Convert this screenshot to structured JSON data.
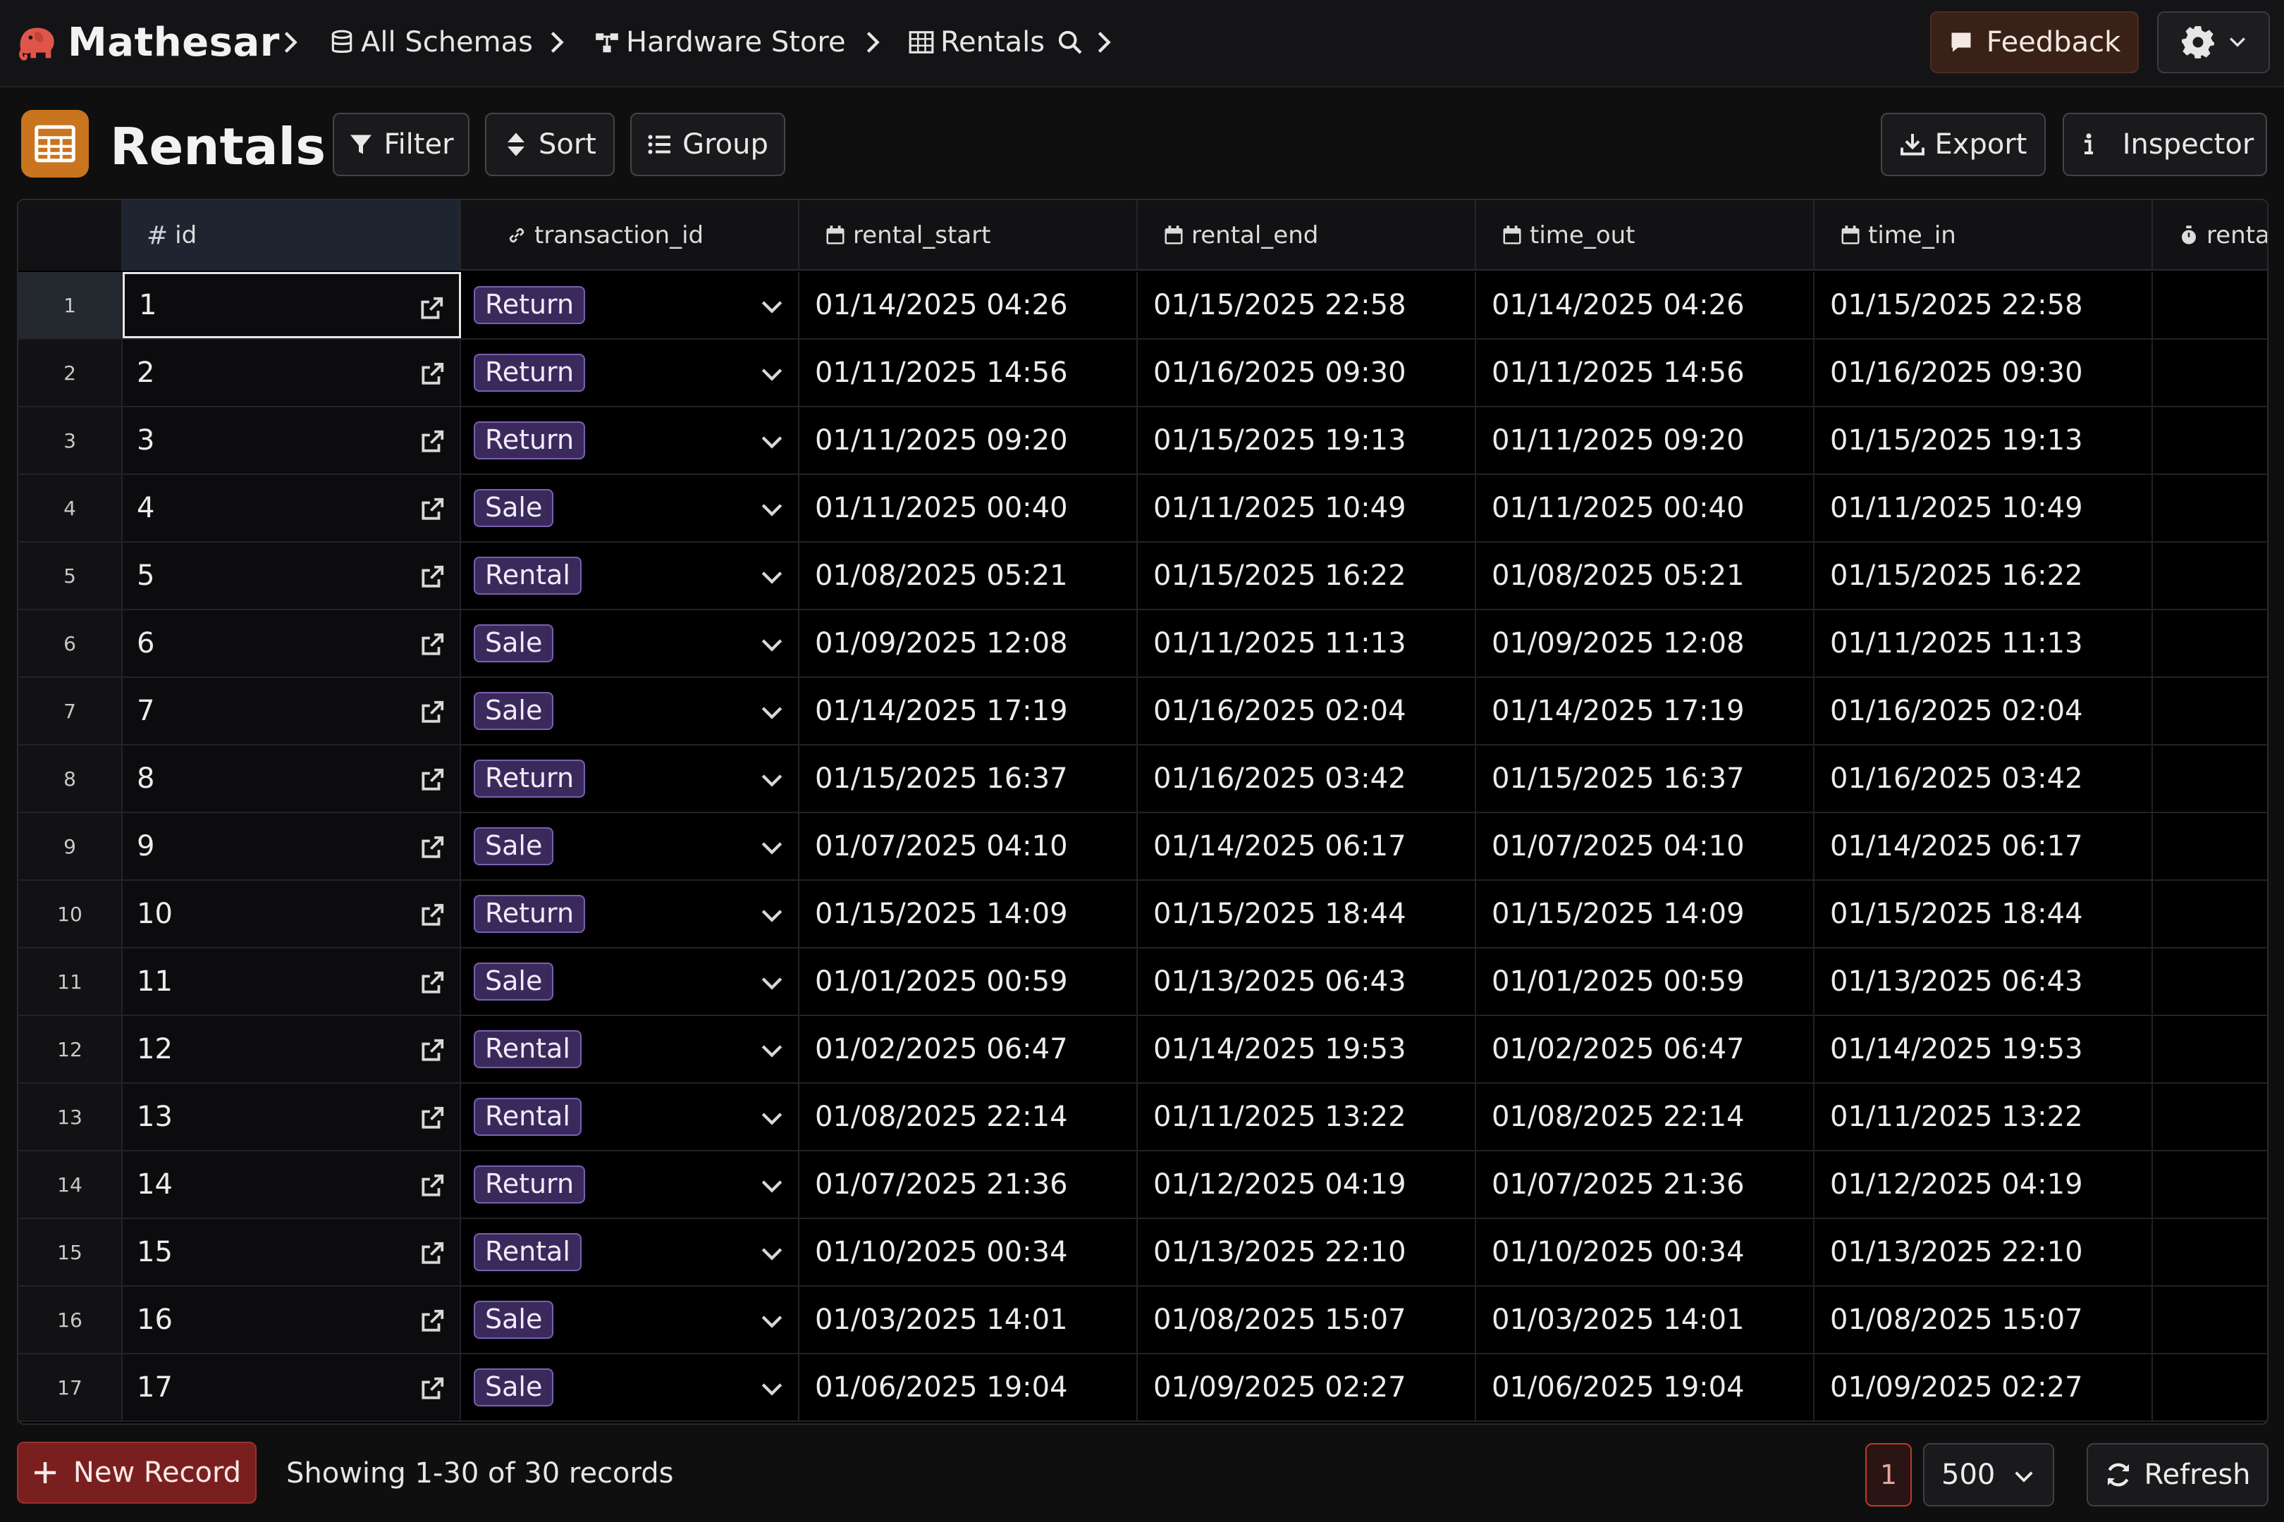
{
  "app": {
    "name": "Mathesar"
  },
  "breadcrumbs": [
    {
      "label": "All Schemas",
      "icon": "database-icon"
    },
    {
      "label": "Hardware Store",
      "icon": "schema-icon"
    },
    {
      "label": "Rentals",
      "icon": "table-icon"
    }
  ],
  "topbar": {
    "feedback_label": "Feedback",
    "settings_icon": "gear-icon"
  },
  "table": {
    "title": "Rentals"
  },
  "actions": {
    "filter": "Filter",
    "sort": "Sort",
    "group": "Group",
    "export": "Export",
    "inspector": "Inspector"
  },
  "columns": [
    {
      "name": "id",
      "icon": "hash-icon"
    },
    {
      "name": "transaction_id",
      "icon": "link-icon"
    },
    {
      "name": "rental_start",
      "icon": "calendar-icon"
    },
    {
      "name": "rental_end",
      "icon": "calendar-icon"
    },
    {
      "name": "time_out",
      "icon": "calendar-icon"
    },
    {
      "name": "time_in",
      "icon": "calendar-icon"
    },
    {
      "name": "renta",
      "icon": "stopwatch-icon"
    }
  ],
  "rows": [
    {
      "n": "1",
      "id": "1",
      "tx": "Return",
      "rs": "01/14/2025 04:26",
      "re": "01/15/2025 22:58",
      "to": "01/14/2025 04:26",
      "ti": "01/15/2025 22:58"
    },
    {
      "n": "2",
      "id": "2",
      "tx": "Return",
      "rs": "01/11/2025 14:56",
      "re": "01/16/2025 09:30",
      "to": "01/11/2025 14:56",
      "ti": "01/16/2025 09:30"
    },
    {
      "n": "3",
      "id": "3",
      "tx": "Return",
      "rs": "01/11/2025 09:20",
      "re": "01/15/2025 19:13",
      "to": "01/11/2025 09:20",
      "ti": "01/15/2025 19:13"
    },
    {
      "n": "4",
      "id": "4",
      "tx": "Sale",
      "rs": "01/11/2025 00:40",
      "re": "01/11/2025 10:49",
      "to": "01/11/2025 00:40",
      "ti": "01/11/2025 10:49"
    },
    {
      "n": "5",
      "id": "5",
      "tx": "Rental",
      "rs": "01/08/2025 05:21",
      "re": "01/15/2025 16:22",
      "to": "01/08/2025 05:21",
      "ti": "01/15/2025 16:22"
    },
    {
      "n": "6",
      "id": "6",
      "tx": "Sale",
      "rs": "01/09/2025 12:08",
      "re": "01/11/2025 11:13",
      "to": "01/09/2025 12:08",
      "ti": "01/11/2025 11:13"
    },
    {
      "n": "7",
      "id": "7",
      "tx": "Sale",
      "rs": "01/14/2025 17:19",
      "re": "01/16/2025 02:04",
      "to": "01/14/2025 17:19",
      "ti": "01/16/2025 02:04"
    },
    {
      "n": "8",
      "id": "8",
      "tx": "Return",
      "rs": "01/15/2025 16:37",
      "re": "01/16/2025 03:42",
      "to": "01/15/2025 16:37",
      "ti": "01/16/2025 03:42"
    },
    {
      "n": "9",
      "id": "9",
      "tx": "Sale",
      "rs": "01/07/2025 04:10",
      "re": "01/14/2025 06:17",
      "to": "01/07/2025 04:10",
      "ti": "01/14/2025 06:17"
    },
    {
      "n": "10",
      "id": "10",
      "tx": "Return",
      "rs": "01/15/2025 14:09",
      "re": "01/15/2025 18:44",
      "to": "01/15/2025 14:09",
      "ti": "01/15/2025 18:44"
    },
    {
      "n": "11",
      "id": "11",
      "tx": "Sale",
      "rs": "01/01/2025 00:59",
      "re": "01/13/2025 06:43",
      "to": "01/01/2025 00:59",
      "ti": "01/13/2025 06:43"
    },
    {
      "n": "12",
      "id": "12",
      "tx": "Rental",
      "rs": "01/02/2025 06:47",
      "re": "01/14/2025 19:53",
      "to": "01/02/2025 06:47",
      "ti": "01/14/2025 19:53"
    },
    {
      "n": "13",
      "id": "13",
      "tx": "Rental",
      "rs": "01/08/2025 22:14",
      "re": "01/11/2025 13:22",
      "to": "01/08/2025 22:14",
      "ti": "01/11/2025 13:22"
    },
    {
      "n": "14",
      "id": "14",
      "tx": "Return",
      "rs": "01/07/2025 21:36",
      "re": "01/12/2025 04:19",
      "to": "01/07/2025 21:36",
      "ti": "01/12/2025 04:19"
    },
    {
      "n": "15",
      "id": "15",
      "tx": "Rental",
      "rs": "01/10/2025 00:34",
      "re": "01/13/2025 22:10",
      "to": "01/10/2025 00:34",
      "ti": "01/13/2025 22:10"
    },
    {
      "n": "16",
      "id": "16",
      "tx": "Sale",
      "rs": "01/03/2025 14:01",
      "re": "01/08/2025 15:07",
      "to": "01/03/2025 14:01",
      "ti": "01/08/2025 15:07"
    },
    {
      "n": "17",
      "id": "17",
      "tx": "Sale",
      "rs": "01/06/2025 19:04",
      "re": "01/09/2025 02:27",
      "to": "01/06/2025 19:04",
      "ti": "01/09/2025 02:27"
    }
  ],
  "footer": {
    "new_record": "New Record",
    "showing": "Showing 1-30 of 30 records",
    "page": "1",
    "per_page": "500",
    "refresh": "Refresh"
  },
  "colors": {
    "accent_orange": "#c9741f",
    "chip_purple": "#3a2a5c",
    "danger_red": "#7a1f1f",
    "selected_header": "#1e2530"
  }
}
